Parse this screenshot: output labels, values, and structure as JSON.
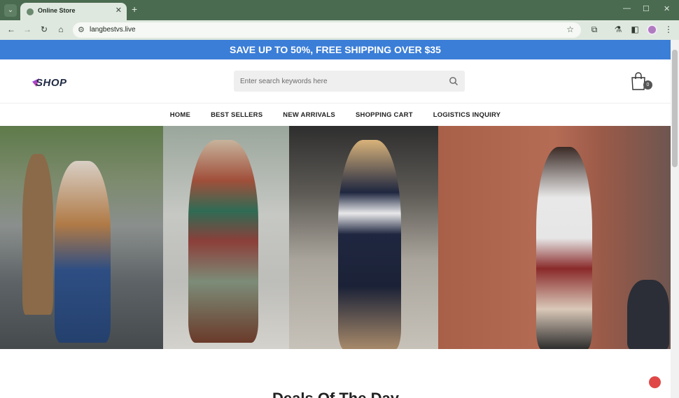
{
  "browser": {
    "tab_title": "Online Store",
    "url": "langbestvs.live",
    "tab_menu_icon": "chevron-down-icon",
    "new_tab_icon": "plus-icon"
  },
  "promo": {
    "text": "SAVE UP TO 50%, FREE SHIPPING OVER $35",
    "background": "#3b7ed8"
  },
  "header": {
    "logo_text": "SHOP",
    "search_placeholder": "Enter search keywords here",
    "cart_count": "0"
  },
  "nav": {
    "items": [
      "HOME",
      "BEST SELLERS",
      "NEW ARRIVALS",
      "SHOPPING CART",
      "LOGISTICS INQUIRY"
    ]
  },
  "section": {
    "title": "Deals Of The Day"
  }
}
